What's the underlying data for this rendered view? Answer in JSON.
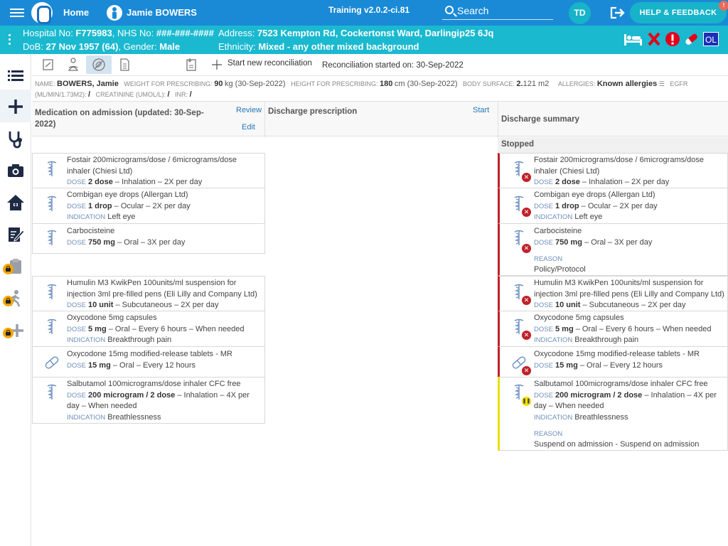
{
  "topbar": {
    "home_label": "Home",
    "patient_name": "Jamie BOWERS",
    "version": "Training v2.0.2-ci.81",
    "search_label": "Search",
    "avatar_initials": "TD",
    "help_label": "HELP & FEEDBACK",
    "help_badge": "!"
  },
  "banner": {
    "line1_prefix": "Hospital No: ",
    "hospital_no": "F775983",
    "nhs_prefix": ", NHS No: ",
    "nhs_no": "###-###-####",
    "address_prefix": "Address: ",
    "address": "7523 Kempton Rd, Cockertonst Ward, Darlingip25 6Jq",
    "dob_prefix": "DoB: ",
    "dob": "27 Nov 1957 (64)",
    "gender_prefix": ", Gender: ",
    "gender": "Male",
    "ethnicity_prefix": "Ethnicity: ",
    "ethnicity": "Mixed - any other mixed background",
    "ol_badge": "OL"
  },
  "toolbar": {
    "new_reconciliation": "Start new reconciliation",
    "started_on": "Reconciliation started on: 30-Sep-2022"
  },
  "info": {
    "name_label": "NAME:",
    "name": "BOWERS, Jamie",
    "weight_label": "WEIGHT FOR PRESCRIBING:",
    "weight": "90",
    "weight_unit": "kg (30-Sep-2022)",
    "height_label": "HEIGHT FOR PRESCRIBING:",
    "height": "180",
    "height_unit": "cm (30-Sep-2022)",
    "bsa_label": "BODY SURFACE:",
    "bsa": "2.",
    "bsa_rest": "121 m2",
    "allergies_label": "ALLERGIES:",
    "allergies": "Known allergies",
    "egfr_label": "EGFR",
    "egfr_unit_label": "(ML/MIN/1.73M2):",
    "egfr": "/",
    "creat_label": "CREATININE (UMOL/L):",
    "creat": "/",
    "inr_label": "INR:",
    "inr": "/"
  },
  "columns": {
    "admission_title": "Medication on admission (updated: 30-Sep-2022)",
    "review_link": "Review",
    "edit_link": "Edit",
    "discharge_title": "Discharge prescription",
    "start_link": "Start",
    "summary_title": "Discharge summary",
    "stopped_header": "Stopped"
  },
  "labels": {
    "dose": "DOSE",
    "indication": "INDICATION",
    "reason": "REASON"
  },
  "admission": [
    {
      "name": "Fostair 200micrograms/dose / 6micrograms/dose inhaler (Chiesi Ltd)",
      "dose": "2 dose",
      "route": " – Inhalation – 2X per day"
    },
    {
      "name": "Combigan eye drops (Allergan Ltd)",
      "dose": "1 drop",
      "route": " – Ocular – 2X per day",
      "indication": "Left eye"
    },
    {
      "name": "Carbocisteine",
      "dose": "750 mg",
      "route": " – Oral – 3X per day"
    },
    {
      "name": "Humulin M3 KwikPen 100units/ml suspension for injection 3ml pre-filled pens (Eli Lilly and Company Ltd)",
      "dose": "10 unit",
      "route": " – Subcutaneous – 2X per day"
    },
    {
      "name": "Oxycodone 5mg capsules",
      "dose": "5 mg",
      "route": " – Oral – Every 6 hours – When needed",
      "indication": "Breakthrough pain"
    },
    {
      "name": "Oxycodone 15mg modified-release tablets - MR",
      "dose": "15 mg",
      "route": " – Oral – Every 12 hours"
    },
    {
      "name": "Salbutamol 100micrograms/dose inhaler CFC free",
      "dose": "200 microgram / 2 dose",
      "route": " – Inhalation – 4X per day – When needed",
      "indication": "Breathlessness"
    }
  ],
  "summary": [
    {
      "name": "Fostair 200micrograms/dose / 6micrograms/dose inhaler (Chiesi Ltd)",
      "dose": "2 dose",
      "route": " – Inhalation – 2X per day"
    },
    {
      "name": "Combigan eye drops (Allergan Ltd)",
      "dose": "1 drop",
      "route": " – Ocular – 2X per day",
      "indication": "Left eye"
    },
    {
      "name": "Carbocisteine",
      "dose": "750 mg",
      "route": " – Oral – 3X per day",
      "reason": "Policy/Protocol"
    },
    {
      "name": "Humulin M3 KwikPen 100units/ml suspension for injection 3ml pre-filled pens (Eli Lilly and Company Ltd)",
      "dose": "10 unit",
      "route": " – Subcutaneous – 2X per day"
    },
    {
      "name": "Oxycodone 5mg capsules",
      "dose": "5 mg",
      "route": " – Oral – Every 6 hours – When needed",
      "indication": "Breakthrough pain"
    },
    {
      "name": "Oxycodone 15mg modified-release tablets - MR",
      "dose": "15 mg",
      "route": " – Oral – Every 12 hours"
    },
    {
      "name": "Salbutamol 100micrograms/dose inhaler CFC free",
      "dose": "200 microgram / 2 dose",
      "route": " – Inhalation – 4X per day – When needed",
      "indication": "Breathlessness",
      "reason": "Suspend on admission - Suspend on admission"
    }
  ],
  "colors": {
    "topbar": "#1a8ad6",
    "banner": "#1bb9d0",
    "stopped": "#c0202a",
    "suspended": "#e8e000"
  }
}
